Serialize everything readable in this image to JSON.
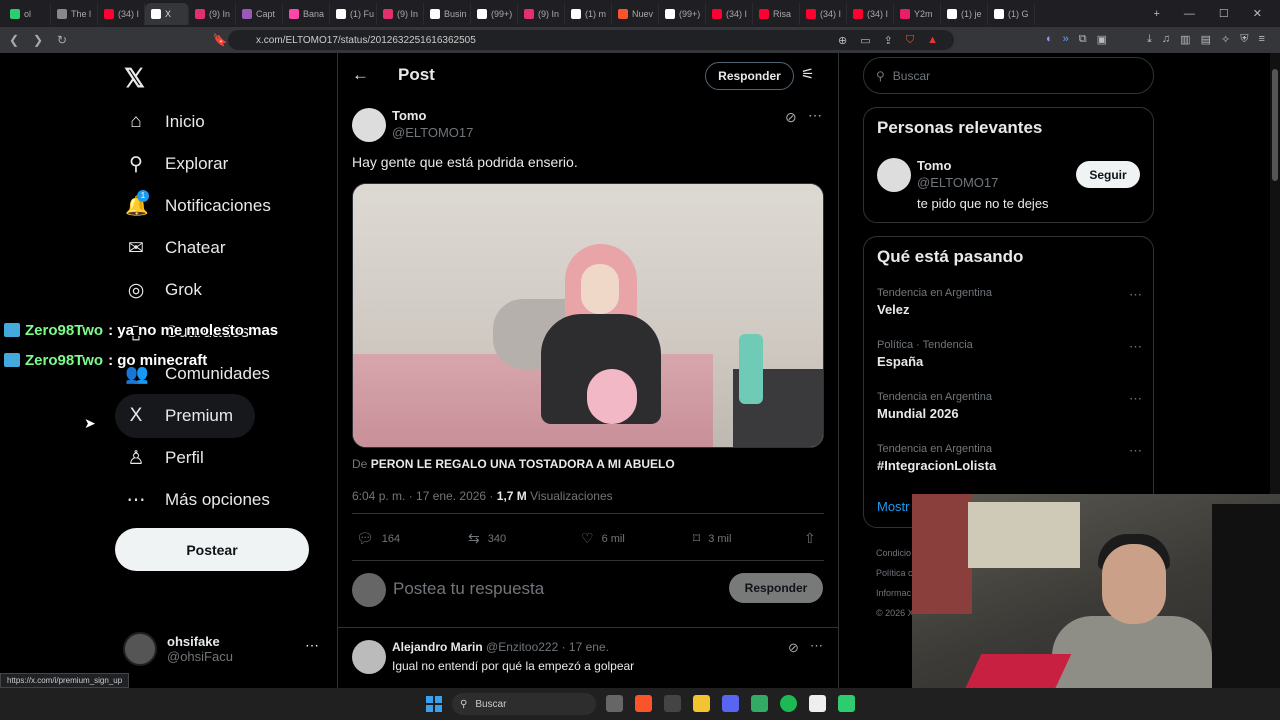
{
  "browser": {
    "tabs": [
      {
        "label": "ol",
        "color": "#2ecc71"
      },
      {
        "label": "The l",
        "color": "#888888"
      },
      {
        "label": "(34) I",
        "color": "#ff0033"
      },
      {
        "label": "X",
        "color": "#ffffff",
        "active": true
      },
      {
        "label": "(9) In",
        "color": "#e1306c"
      },
      {
        "label": "Capt",
        "color": "#9b59b6"
      },
      {
        "label": "Bana",
        "color": "#ff44aa"
      },
      {
        "label": "(1) Fu",
        "color": "#ffffff"
      },
      {
        "label": "(9) In",
        "color": "#e1306c"
      },
      {
        "label": "Busin",
        "color": "#ffffff"
      },
      {
        "label": "(99+)",
        "color": "#ffffff"
      },
      {
        "label": "(9) In",
        "color": "#e1306c"
      },
      {
        "label": "(1) m",
        "color": "#ffffff"
      },
      {
        "label": "Nuev",
        "color": "#fb542b"
      },
      {
        "label": "(99+)",
        "color": "#ffffff"
      },
      {
        "label": "(34) I",
        "color": "#ff0033"
      },
      {
        "label": "Risa",
        "color": "#ff0033"
      },
      {
        "label": "(34) I",
        "color": "#ff0033"
      },
      {
        "label": "(34) I",
        "color": "#ff0033"
      },
      {
        "label": "Y2m",
        "color": "#e91e63"
      },
      {
        "label": "(1) je",
        "color": "#ffffff"
      },
      {
        "label": "(1) G",
        "color": "#ffffff"
      }
    ],
    "url": "x.com/ELTOMO17/status/2012632251616362505",
    "status_url": "https://x.com/i/premium_sign_up"
  },
  "nav": {
    "items": [
      {
        "label": "Inicio",
        "icon": "⌂"
      },
      {
        "label": "Explorar",
        "icon": "⚲"
      },
      {
        "label": "Notificaciones",
        "icon": "🔔"
      },
      {
        "label": "Chatear",
        "icon": "✉"
      },
      {
        "label": "Grok",
        "icon": "◎"
      },
      {
        "label": "Guardados",
        "icon": "▯"
      },
      {
        "label": "Comunidades",
        "icon": "👥"
      },
      {
        "label": "Premium",
        "icon": "X"
      },
      {
        "label": "Perfil",
        "icon": "♙"
      },
      {
        "label": "Más opciones",
        "icon": "⋯"
      }
    ],
    "notif_count": "1",
    "post_button": "Postear"
  },
  "account": {
    "name": "ohsifake",
    "handle": "@ohsiFacu"
  },
  "chat_overlay": [
    {
      "user": "Zero98Two",
      "message": ": ya no me molesto mas"
    },
    {
      "user": "Zero98Two",
      "message": ": go minecraft"
    }
  ],
  "post_view": {
    "title": "Post",
    "reply_button": "Responder",
    "author_name": "Tomo",
    "author_handle": "@ELTOMO17",
    "text": "Hay gente que está podrida enserio.",
    "source_prefix": "De",
    "source_title": "PERON LE REGALO UNA TOSTADORA A MI ABUELO",
    "time": "6:04 p. m. · 17 ene. 2026 · ",
    "views": "1,7 M",
    "views_label": "Visualizaciones",
    "actions": {
      "replies": "164",
      "reposts": "340",
      "likes": "6 mil",
      "bookmarks": "3 mil"
    },
    "reply_placeholder": "Postea tu respuesta",
    "reply_submit": "Responder"
  },
  "comment": {
    "name": "Alejandro Marin",
    "handle_date": "@Enzitoo222 · 17 ene.",
    "text": "Igual no entendí por qué la empezó a golpear"
  },
  "sidebar": {
    "search_placeholder": "Buscar",
    "relevant_title": "Personas relevantes",
    "relevant": {
      "name": "Tomo",
      "handle": "@ELTOMO17",
      "bio": "te pido que no te dejes",
      "follow": "Seguir"
    },
    "trends_title": "Qué está pasando",
    "trends": [
      {
        "context": "Tendencia en Argentina",
        "name": "Velez"
      },
      {
        "context": "Política · Tendencia",
        "name": "España"
      },
      {
        "context": "Tendencia en Argentina",
        "name": "Mundial 2026"
      },
      {
        "context": "Tendencia en Argentina",
        "name": "#IntegracionLolista"
      }
    ],
    "show_more": "Mostr",
    "footer": [
      "Condicio",
      "Política c",
      "Informac",
      "© 2026 X"
    ]
  },
  "taskbar": {
    "search": "Buscar"
  }
}
